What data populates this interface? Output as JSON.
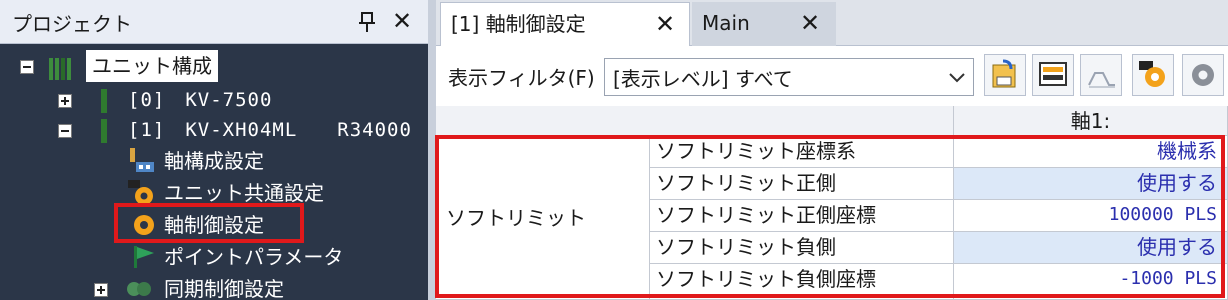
{
  "project_pane": {
    "title": "プロジェクト",
    "pin_icon": "pin-icon",
    "close_icon": "close-icon",
    "tree": [
      {
        "label": "ユニット構成",
        "icon": "unit-config-icon",
        "expander": "minus",
        "selected": true
      },
      {
        "label": "[0]　KV-7500",
        "icon": "cpu-unit-icon",
        "expander": "plus"
      },
      {
        "label": "[1]　KV-XH04ML　　R34000",
        "icon": "motion-unit-icon",
        "expander": "minus"
      },
      {
        "label": "軸構成設定",
        "icon": "axis-config-icon"
      },
      {
        "label": "ユニット共通設定",
        "icon": "gear-icon"
      },
      {
        "label": "軸制御設定",
        "icon": "gear-icon",
        "highlighted": true
      },
      {
        "label": "ポイントパラメータ",
        "icon": "flag-icon"
      },
      {
        "label": "同期制御設定",
        "icon": "sync-icon",
        "expander": "plus"
      }
    ]
  },
  "tabs": [
    {
      "label": "[1] 軸制御設定",
      "active": true,
      "close_icon": "close-icon"
    },
    {
      "label": "Main",
      "active": false,
      "close_icon": "close-icon"
    }
  ],
  "filter": {
    "label": "表示フィルタ(F)",
    "value": "[表示レベル] すべて",
    "arrow_icon": "chevron-down-icon"
  },
  "toolbar_icons": [
    "open-file-icon",
    "monitor-icon",
    "chart-icon",
    "settings-gear-icon",
    "gear-icon"
  ],
  "grid": {
    "column_header": "軸1:",
    "group_label": "ソフトリミット",
    "rows": [
      {
        "name": "ソフトリミット座標系",
        "value": "機械系",
        "highlighted": false
      },
      {
        "name": "ソフトリミット正側",
        "value": "使用する",
        "highlighted": true
      },
      {
        "name": "ソフトリミット正側座標",
        "value": "100000 PLS",
        "highlighted": false
      },
      {
        "name": "ソフトリミット負側",
        "value": "使用する",
        "highlighted": true
      },
      {
        "name": "ソフトリミット負側座標",
        "value": "-1000 PLS",
        "highlighted": false
      }
    ]
  },
  "colors": {
    "highlight_box": "#e0191b",
    "value_text": "#2b2fae",
    "pane_background": "#2b3648"
  }
}
